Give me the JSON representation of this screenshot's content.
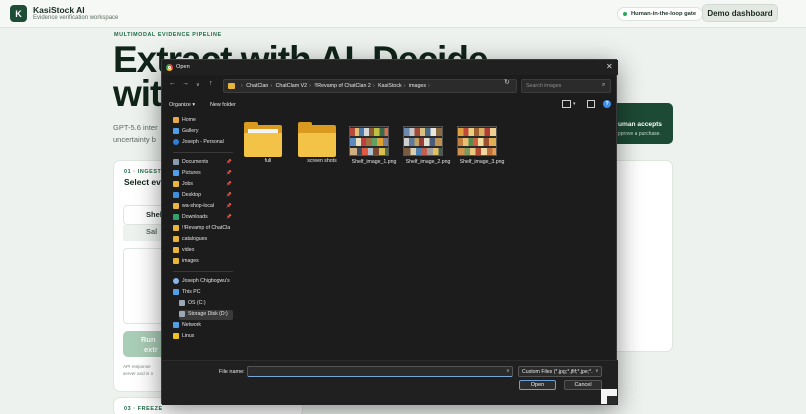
{
  "app": {
    "logo_letter": "K",
    "title": "KasiStock AI",
    "subtitle": "Evidence verification workspace",
    "hitl_badge": "Human-in-the-loop gate",
    "demo_button": "Demo dashboard"
  },
  "hero": {
    "eyebrow": "MULTIMODAL EVIDENCE PIPELINE",
    "line1": "Extract with AI. Decide",
    "line2": "wit",
    "desc1": "GPT-5.6 inter",
    "desc2": "uncertainty b"
  },
  "accept_card": {
    "title": "uman accepts",
    "subtitle": "pprove a purchase."
  },
  "step1": {
    "eyebrow": "01 · INGEST",
    "title": "Select ev",
    "tab_shelf": "Shel",
    "tab_sale": "Sal",
    "run_line1": "Run",
    "run_line2": "extr",
    "api_line1": "API response",
    "api_line2": "server and is n"
  },
  "step3": {
    "eyebrow": "03 · FREEZE"
  },
  "dialog": {
    "title": "Open",
    "breadcrumbs": [
      "ChatClan",
      "ChatClam V2",
      "!!Revamp of ChatClan 2",
      "KasiStock",
      "images"
    ],
    "search_placeholder": "Search images",
    "organize": "Organize ▾",
    "new_folder": "New folder",
    "nav_items": [
      {
        "label": "Home",
        "icon": "home-icon"
      },
      {
        "label": "Gallery",
        "icon": "gallery-icon"
      },
      {
        "label": "Joseph - Personal",
        "icon": "cloud-icon"
      },
      {
        "label": "Documents",
        "icon": "documents-icon"
      },
      {
        "label": "Pictures",
        "icon": "pictures-icon"
      },
      {
        "label": "Jobs",
        "icon": "folder-icon"
      },
      {
        "label": "Desktop",
        "icon": "desktop-icon"
      },
      {
        "label": "wa-shop-local",
        "icon": "folder-icon"
      },
      {
        "label": "Downloads",
        "icon": "downloads-icon"
      },
      {
        "label": "!!Revamp of ChatCla",
        "icon": "folder-icon"
      },
      {
        "label": "catalogues",
        "icon": "folder-icon"
      },
      {
        "label": "video",
        "icon": "folder-icon"
      },
      {
        "label": "images",
        "icon": "folder-icon"
      },
      {
        "label": "Joseph Chigbogwu's",
        "icon": "user-icon"
      },
      {
        "label": "This PC",
        "icon": "pc-icon"
      },
      {
        "label": "OS (C:)",
        "icon": "drive-icon"
      },
      {
        "label": "Storage Disk (D:)",
        "icon": "drive-icon"
      },
      {
        "label": "Network",
        "icon": "network-icon"
      },
      {
        "label": "Linux",
        "icon": "linux-icon"
      }
    ],
    "files": [
      {
        "name": "full",
        "kind": "folder"
      },
      {
        "name": "screen shots",
        "kind": "folder"
      },
      {
        "name": "Shelf_image_1.png",
        "kind": "image"
      },
      {
        "name": "Shelf_image_2.png",
        "kind": "image"
      },
      {
        "name": "Shelf_image_3.png",
        "kind": "image"
      }
    ],
    "file_name_label": "File name:",
    "file_name_value": "",
    "filter": "Custom Files (*.jpg;*.jfif;*.jpe;*.",
    "open_button": "Open",
    "cancel_button": "Cancel"
  },
  "colors": {
    "brand": "#1d4d35",
    "accent_green": "#1f6a46",
    "dialog_bg": "#1c1c1c",
    "folder_yellow": "#f3c347"
  }
}
